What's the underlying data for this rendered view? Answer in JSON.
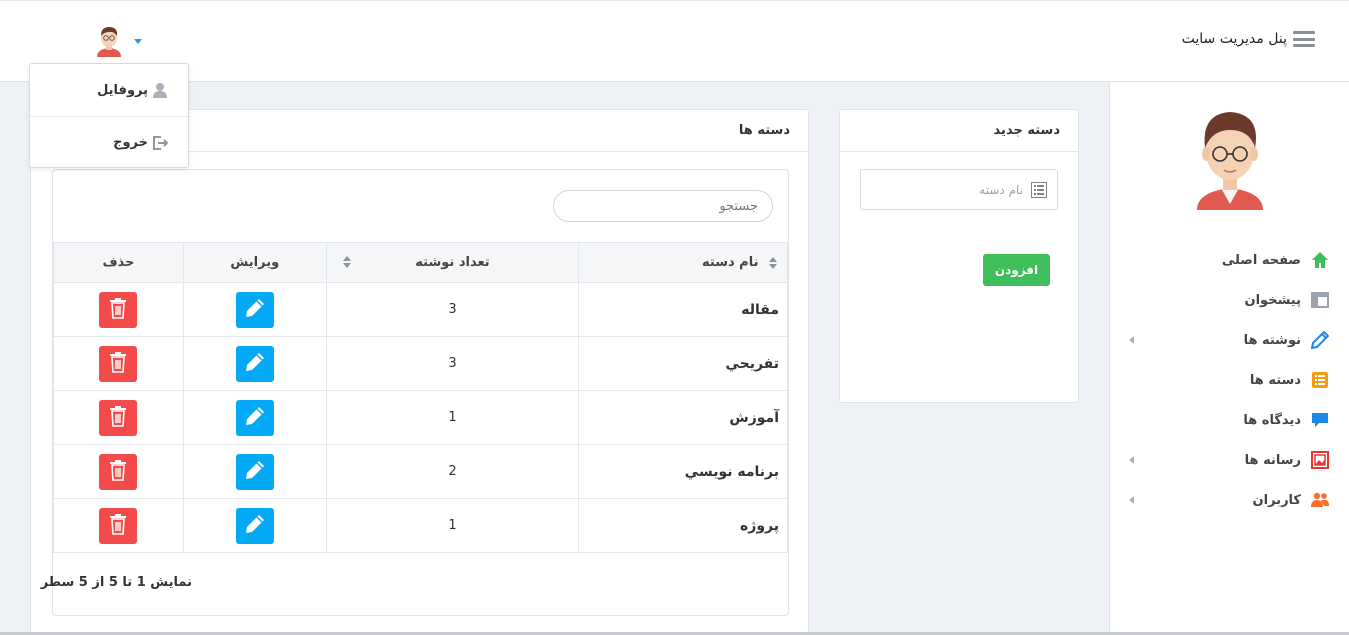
{
  "header": {
    "title": "پنل مدیریت سایت",
    "menu_icon": "hamburger-icon",
    "user_avatar": "avatar-icon"
  },
  "user_menu": {
    "items": [
      {
        "label": "پروفایل",
        "icon": "user-icon"
      },
      {
        "label": "خروج",
        "icon": "logout-icon"
      }
    ]
  },
  "sidebar": {
    "items": [
      {
        "label": "صفحه اصلی",
        "icon": "home-icon",
        "color": "#3fbe5c",
        "has_arrow": false
      },
      {
        "label": "پیشخوان",
        "icon": "dashboard-icon",
        "color": "#9aa3ad",
        "has_arrow": false
      },
      {
        "label": "نوشته ها",
        "icon": "pencil-icon",
        "color": "#1e88e5",
        "has_arrow": true
      },
      {
        "label": "دسته ها",
        "icon": "list-icon",
        "color": "#f39c12",
        "has_arrow": false
      },
      {
        "label": "دیدگاه ها",
        "icon": "comment-icon",
        "color": "#1e88e5",
        "has_arrow": false
      },
      {
        "label": "رسانه ها",
        "icon": "image-icon",
        "color": "#e53935",
        "has_arrow": true
      },
      {
        "label": "کاربران",
        "icon": "users-icon",
        "color": "#ff6d2e",
        "has_arrow": true
      }
    ]
  },
  "new_category": {
    "title": "دسته جدید",
    "name_placeholder": "نام دسته",
    "add_label": "افزودن"
  },
  "categories": {
    "title": "دسته ها",
    "search_placeholder": "جستجو",
    "columns": [
      "نام دسته",
      "تعداد نوشته",
      "ویرایش",
      "حذف"
    ],
    "rows": [
      {
        "name": "مقاله",
        "count": "3"
      },
      {
        "name": "تفريحي",
        "count": "3"
      },
      {
        "name": "آموزش",
        "count": "1"
      },
      {
        "name": "برنامه نويسي",
        "count": "2"
      },
      {
        "name": "پروژه",
        "count": "1"
      }
    ],
    "info": "نمایش 1 تا 5 از 5 سطر"
  },
  "colors": {
    "edit": "#03a9f4",
    "delete": "#f34a4a",
    "add": "#3fbe5c"
  }
}
